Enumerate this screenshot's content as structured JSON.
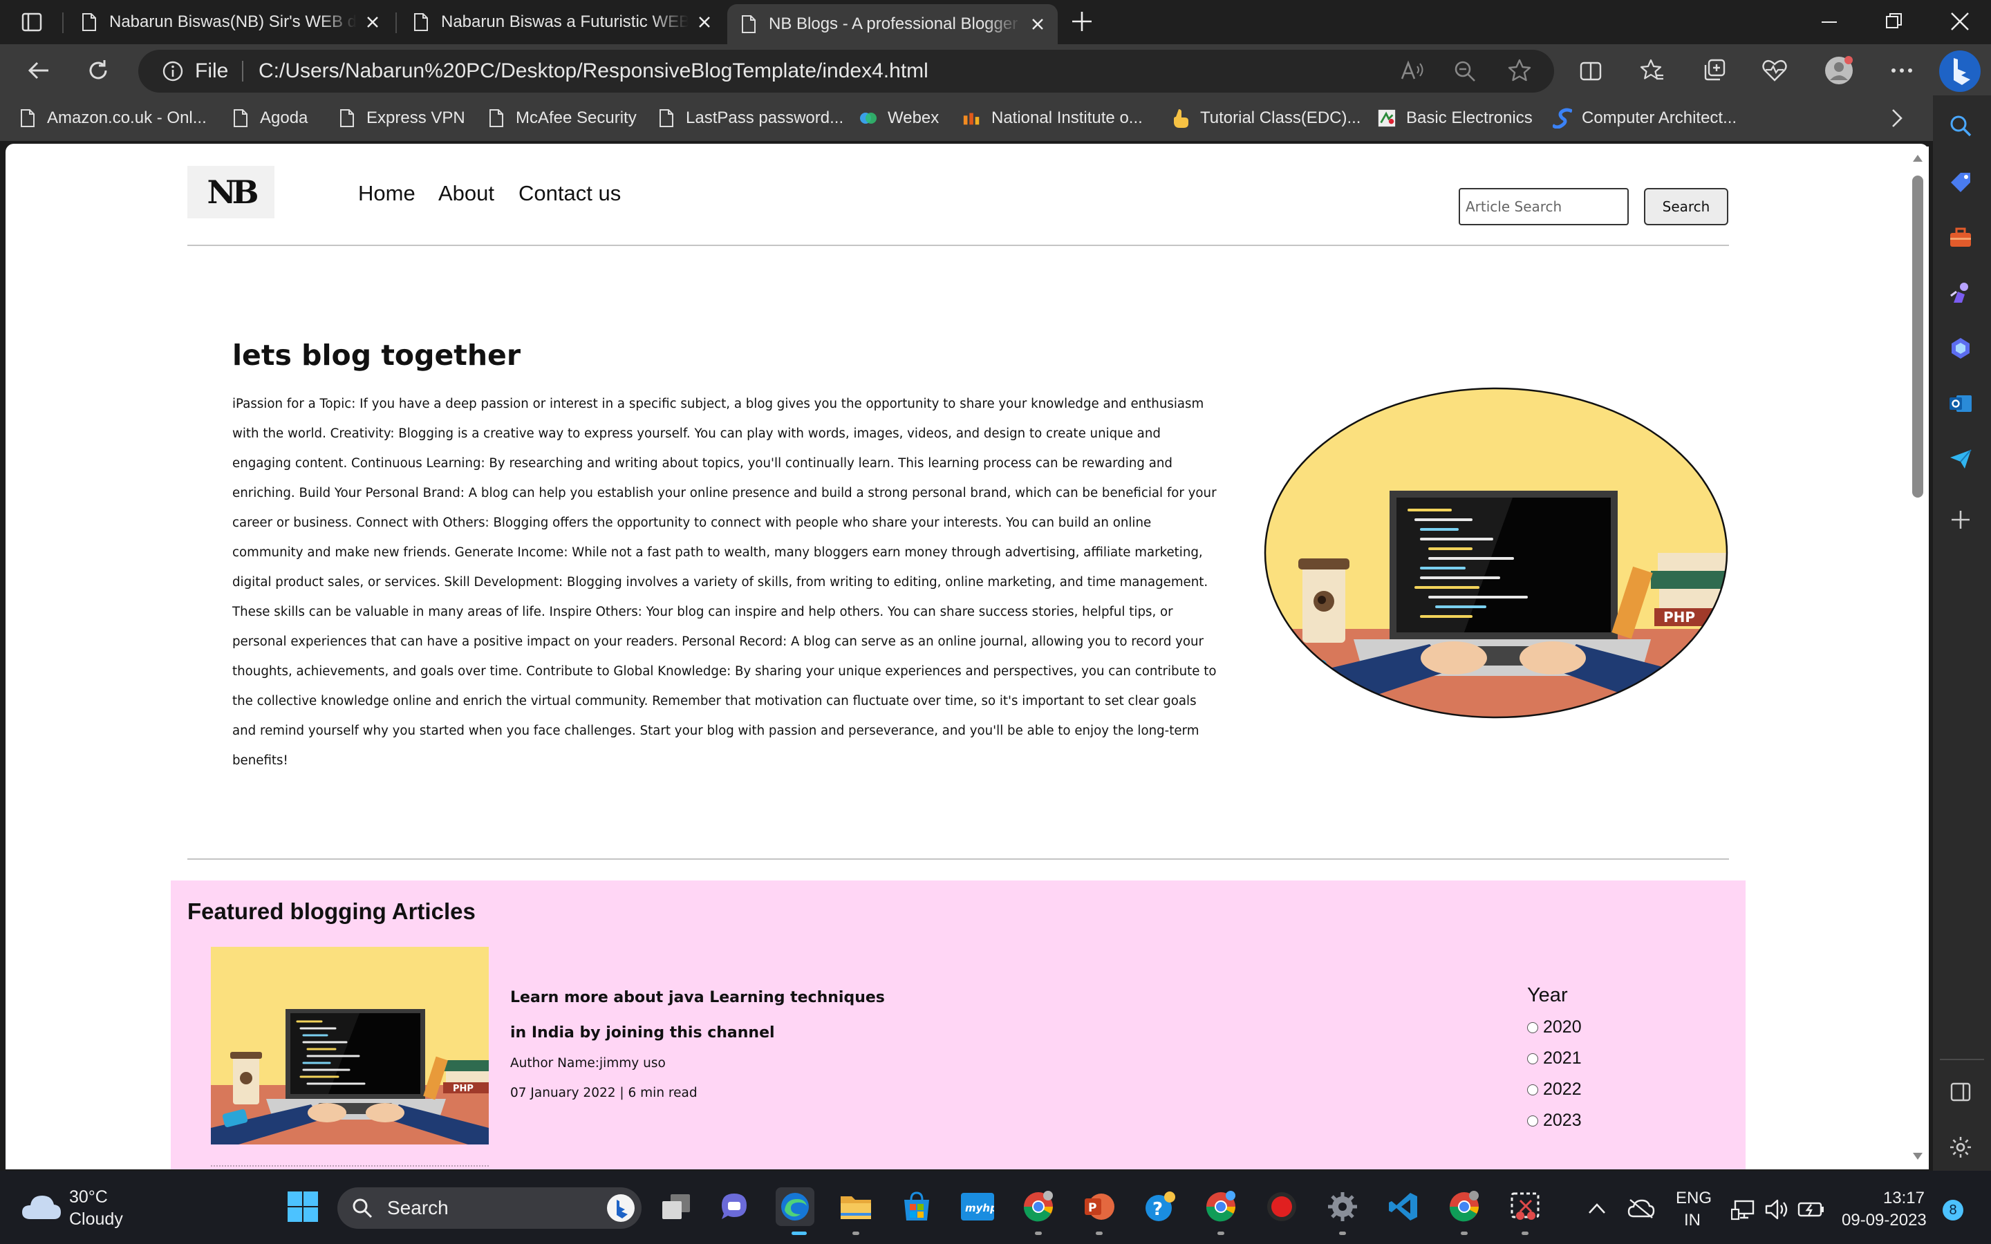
{
  "browser": {
    "tabs": [
      {
        "title": "Nabarun Biswas(NB) Sir's WEB design"
      },
      {
        "title": "Nabarun Biswas a Futuristic WEB"
      },
      {
        "title": "NB Blogs - A professional Blogger"
      }
    ],
    "address": {
      "scheme_label": "File",
      "url": "C:/Users/Nabarun%20PC/Desktop/ResponsiveBlogTemplate/index4.html"
    },
    "bookmarks": [
      {
        "label": "Amazon.co.uk - Onl...",
        "icon": "page-icon"
      },
      {
        "label": "Agoda",
        "icon": "page-icon"
      },
      {
        "label": "Express VPN",
        "icon": "page-icon"
      },
      {
        "label": "McAfee Security",
        "icon": "page-icon"
      },
      {
        "label": "LastPass password...",
        "icon": "page-icon"
      },
      {
        "label": "Webex",
        "icon": "webex-icon"
      },
      {
        "label": "National Institute o...",
        "icon": "nit-icon"
      },
      {
        "label": "Tutorial Class(EDC)...",
        "icon": "finger-icon"
      },
      {
        "label": "Basic Electronics",
        "icon": "electronics-icon"
      },
      {
        "label": "Computer Architect...",
        "icon": "s-icon"
      }
    ]
  },
  "site": {
    "logo": "NB",
    "nav": {
      "home": "Home",
      "about": "About",
      "contact": "Contact us"
    },
    "search": {
      "placeholder": "Article Search",
      "button": "Search"
    },
    "hero": {
      "title": "lets blog together",
      "body": "iPassion for a Topic: If you have a deep passion or interest in a specific subject, a blog gives you the opportunity to share your knowledge and enthusiasm with the world. Creativity: Blogging is a creative way to express yourself. You can play with words, images, videos, and design to create unique and engaging content. Continuous Learning: By researching and writing about topics, you'll continually learn. This learning process can be rewarding and enriching. Build Your Personal Brand: A blog can help you establish your online presence and build a strong personal brand, which can be beneficial for your career or business. Connect with Others: Blogging offers the opportunity to connect with people who share your interests. You can build an online community and make new friends. Generate Income: While not a fast path to wealth, many bloggers earn money through advertising, affiliate marketing, digital product sales, or services. Skill Development: Blogging involves a variety of skills, from writing to editing, online marketing, and time management. These skills can be valuable in many areas of life. Inspire Others: Your blog can inspire and help others. You can share success stories, helpful tips, or personal experiences that can have a positive impact on your readers. Personal Record: A blog can serve as an online journal, allowing you to record your thoughts, achievements, and goals over time. Contribute to Global Knowledge: By sharing your unique experiences and perspectives, you can contribute to the collective knowledge online and enrich the virtual community. Remember that motivation can fluctuate over time, so it's important to set clear goals and remind yourself why you started when you face challenges. Start your blog with passion and perseverance, and you'll be able to enjoy the long-term benefits!"
    },
    "featured": {
      "heading": "Featured blogging Articles",
      "article": {
        "title": "Learn more about java Learning techniques in India by joining this channel",
        "author": "Author Name:jimmy uso",
        "meta": "07 January 2022 | 6 min read"
      },
      "year_filter": {
        "title": "Year",
        "options": [
          "2020",
          "2021",
          "2022",
          "2023"
        ]
      }
    }
  },
  "taskbar": {
    "weather": {
      "temp": "30°C",
      "condition": "Cloudy"
    },
    "search_label": "Search",
    "language": {
      "line1": "ENG",
      "line2": "IN"
    },
    "clock": {
      "time": "13:17",
      "date": "09-09-2023"
    },
    "notification_count": "8"
  },
  "colors": {
    "featured_bg": "#ffd6f5",
    "hero_circle": "#fbe07e",
    "desk": "#d8785a",
    "sleeve": "#1f3b73"
  }
}
